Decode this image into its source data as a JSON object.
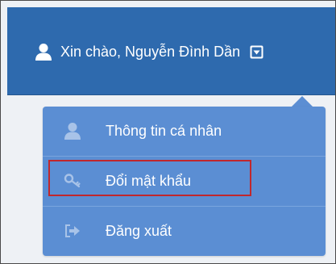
{
  "header": {
    "greeting": "Xin chào, Nguyễn Đình Dần",
    "user_icon": "user-icon",
    "toggle_icon": "caret-down-box-icon"
  },
  "dropdown": {
    "items": [
      {
        "label": "Thông tin cá nhân",
        "icon": "user-icon"
      },
      {
        "label": "Đổi mật khẩu",
        "icon": "key-icon",
        "highlighted": true
      },
      {
        "label": "Đăng xuất",
        "icon": "sign-out-icon"
      }
    ]
  },
  "colors": {
    "header_bg": "#2e6aae",
    "menu_bg": "#5b8ed3",
    "highlight_border": "#c0272d",
    "text": "#ffffff"
  }
}
